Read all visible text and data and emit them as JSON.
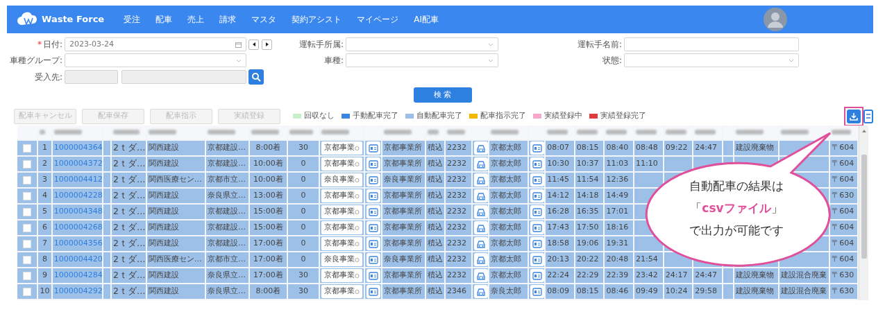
{
  "navbar": {
    "brand": "Waste Force",
    "items": [
      {
        "label": "受注"
      },
      {
        "label": "配車"
      },
      {
        "label": "売上"
      },
      {
        "label": "請求"
      },
      {
        "label": "マスタ"
      },
      {
        "label": "契約アシスト"
      },
      {
        "label": "マイページ"
      },
      {
        "label": "AI配車"
      }
    ]
  },
  "filters": [
    [
      {
        "kind": "date",
        "label": "日付:",
        "required_mark": "*",
        "value": "2023-03-24"
      },
      {
        "kind": "select",
        "label": "運転手所属:"
      },
      {
        "kind": "text",
        "label": "運転手名前:"
      }
    ],
    [
      {
        "kind": "select",
        "label": "車種グループ:"
      },
      {
        "kind": "select",
        "label": "車種:"
      },
      {
        "kind": "select",
        "label": "状態:"
      }
    ],
    [
      {
        "kind": "pair",
        "label": "受入先:",
        "disabled": true
      }
    ]
  ],
  "search_button": "検 索",
  "toolbar": [
    {
      "label": "配車キャンセル",
      "disabled": true
    },
    {
      "label": "配車保存",
      "disabled": true
    },
    {
      "label": "配車指示",
      "disabled": true
    },
    {
      "label": "実績登録",
      "disabled": true
    }
  ],
  "legend": [
    {
      "label": "回収なし",
      "color": "#c8f0c8"
    },
    {
      "label": "手動配車完了",
      "color": "#3a86e0"
    },
    {
      "label": "自動配車完了",
      "color": "#9dc0e8"
    },
    {
      "label": "配車指示完了",
      "color": "#f5b800"
    },
    {
      "label": "実績登録中",
      "color": "#f5a8c8"
    },
    {
      "label": "実績登録完了",
      "color": "#e03c3c"
    }
  ],
  "rows": [
    {
      "checked": false,
      "color": "#9dc0e8",
      "no": "1",
      "order_id": "1000004364",
      "vehicle": "2ｔダ…",
      "customer": "関西建設",
      "site": "京都建設…",
      "arrival": "8:00着",
      "qty": "30",
      "office_select": "京都事業",
      "office": "京都事業所",
      "work": "積込",
      "code": "2232",
      "driver": "京都太郎",
      "time_1": "08:07",
      "time_2": "08:15",
      "time_3": "08:40",
      "time_4": "08:48",
      "time_5": "09:22",
      "time_6": "24:47",
      "waste": "建設廃棄物",
      "zip": "〒604"
    },
    {
      "checked": false,
      "color": "#9dc0e8",
      "no": "2",
      "order_id": "1000004372",
      "vehicle": "2ｔダ…",
      "customer": "関西建設",
      "site": "京都建設…",
      "arrival": "10:00着",
      "qty": "0",
      "office_select": "京都事業",
      "office": "京都事業所",
      "work": "積込",
      "code": "2232",
      "driver": "京都太郎",
      "time_1": "10:30",
      "time_2": "10:37",
      "time_3": "11:03",
      "time_4": "11:10",
      "zip": "〒604"
    },
    {
      "checked": false,
      "color": "#9dc0e8",
      "no": "3",
      "order_id": "1000004412",
      "vehicle": "2ｔダ…",
      "customer": "関西医療セン…",
      "site": "京都市立…",
      "arrival": "10:00着",
      "qty": "0",
      "office_select": "奈良事業",
      "office": "奈良事業所",
      "work": "積込",
      "code": "2232",
      "driver": "京都太郎",
      "time_1": "11:45",
      "time_2": "11:54",
      "time_3": "12:36",
      "zip": "〒604"
    },
    {
      "checked": false,
      "color": "#9dc0e8",
      "no": "4",
      "order_id": "1000004228",
      "vehicle": "2ｔダ…",
      "customer": "関西建設",
      "site": "奈良県立…",
      "arrival": "13:00着",
      "qty": "0",
      "office_select": "京都事業",
      "office": "京都事業所",
      "work": "積込",
      "code": "2232",
      "driver": "京都太郎",
      "time_1": "14:12",
      "time_2": "14:18",
      "time_3": "14:49",
      "zip": "〒630"
    },
    {
      "checked": false,
      "color": "#9dc0e8",
      "no": "5",
      "order_id": "1000004348",
      "vehicle": "2ｔダ…",
      "customer": "関西建設",
      "site": "京都建設…",
      "arrival": "15:00着",
      "qty": "0",
      "office_select": "京都事業",
      "office": "京都事業所",
      "work": "積込",
      "code": "2232",
      "driver": "京都太郎",
      "time_1": "16:28",
      "time_2": "16:35",
      "time_3": "17:01",
      "zip": "〒604"
    },
    {
      "checked": false,
      "color": "#9dc0e8",
      "no": "6",
      "order_id": "1000004268",
      "vehicle": "2ｔダ…",
      "customer": "関西建設",
      "site": "京都建設…",
      "arrival": "15:00着",
      "qty": "0",
      "office_select": "京都事業",
      "office": "京都事業所",
      "work": "積込",
      "code": "2232",
      "driver": "京都太郎",
      "time_1": "17:43",
      "time_2": "17:50",
      "time_3": "18:16",
      "zip": "〒604"
    },
    {
      "checked": false,
      "color": "#9dc0e8",
      "no": "7",
      "order_id": "1000004356",
      "vehicle": "2ｔダ…",
      "customer": "関西建設",
      "site": "京都建設…",
      "arrival": "17:00着",
      "qty": "0",
      "office_select": "京都事業",
      "office": "京都事業所",
      "work": "積込",
      "code": "2232",
      "driver": "京都太郎",
      "time_1": "18:58",
      "time_2": "19:06",
      "time_3": "19:31",
      "zip": "〒604"
    },
    {
      "checked": false,
      "color": "#9dc0e8",
      "no": "8",
      "order_id": "1000004420",
      "vehicle": "2ｔダ…",
      "customer": "関西医療セン…",
      "site": "京都市立…",
      "arrival": "17:00着",
      "qty": "0",
      "office_select": "奈良事業",
      "office": "奈良事業所",
      "work": "積込",
      "code": "2232",
      "driver": "京都太郎",
      "time_1": "20:13",
      "time_2": "20:22",
      "time_3": "20:48",
      "time_4": "21:54",
      "zip": "〒604"
    },
    {
      "checked": false,
      "color": "#9dc0e8",
      "no": "9",
      "order_id": "1000004284",
      "vehicle": "2ｔダ…",
      "customer": "関西建設",
      "site": "奈良県立…",
      "arrival": "17:00着",
      "qty": "30",
      "office_select": "京都事業",
      "office": "京都事業所",
      "work": "積込",
      "code": "2232",
      "driver": "京都太郎",
      "time_1": "22:24",
      "time_2": "22:29",
      "time_3": "22:39",
      "time_4": "23:42",
      "time_5": "24:17",
      "time_6": "24:47",
      "waste": "建設廃棄物",
      "waste_detail": "建設混合廃棄",
      "zip": "〒630"
    },
    {
      "checked": false,
      "color": "#9dc0e8",
      "no": "10",
      "order_id": "1000004292",
      "vehicle": "2ｔダ…",
      "customer": "関西建設",
      "site": "奈良県立…",
      "arrival": "8:00着",
      "qty": "30",
      "office_select": "京都事業",
      "office": "京都事業所",
      "work": "積込",
      "code": "2346",
      "driver": "奈良太郎",
      "time_1": "08:09",
      "time_2": "08:15",
      "time_3": "08:46",
      "time_4": "09:49",
      "time_5": "10:24",
      "time_6": "29:58",
      "waste": "建設廃棄物",
      "waste_detail": "建設混合廃棄",
      "zip": "〒630"
    }
  ],
  "callout": {
    "lines": [
      "自動配車の結果は",
      "「**csvファイル**」",
      "で出力が可能です"
    ]
  }
}
